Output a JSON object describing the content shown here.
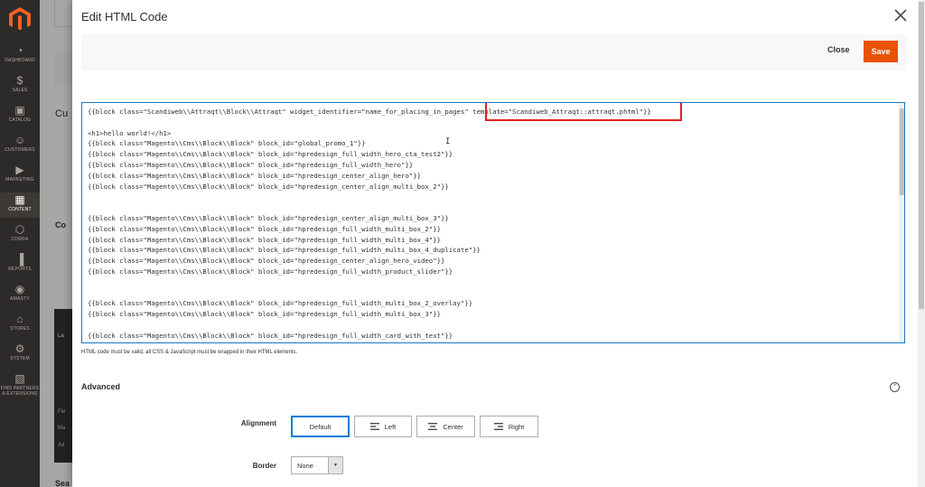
{
  "sidebar": {
    "items": [
      {
        "label": "DASHBOARD",
        "icon": "dashboard-icon"
      },
      {
        "label": "SALES",
        "icon": "dollar-icon"
      },
      {
        "label": "CATALOG",
        "icon": "cube-icon"
      },
      {
        "label": "CUSTOMERS",
        "icon": "person-icon"
      },
      {
        "label": "MARKETING",
        "icon": "megaphone-icon"
      },
      {
        "label": "CONTENT",
        "icon": "layout-icon"
      },
      {
        "label": "CORRA",
        "icon": "hexagon-icon"
      },
      {
        "label": "REPORTS",
        "icon": "bar-chart-icon"
      },
      {
        "label": "AMASTY",
        "icon": "amasty-icon"
      },
      {
        "label": "STORES",
        "icon": "store-icon"
      },
      {
        "label": "SYSTEM",
        "icon": "gear-icon"
      },
      {
        "label": "FIND PARTNERS & EXTENSIONS",
        "icon": "box-icon"
      }
    ],
    "active": "CONTENT"
  },
  "background": {
    "text_cu": "Cu",
    "text_co": "Co",
    "text_la": "La",
    "text_fle": "Fle",
    "text_ma": "Ma",
    "text_ad": "Ad",
    "text_sea": "Sea"
  },
  "modal": {
    "title": "Edit HTML Code",
    "close_label": "Close",
    "save_label": "Save"
  },
  "code": {
    "lines": [
      "{{block class=\"Scandiweb\\\\Attraqt\\\\Block\\\\Attraqt\" widget_identifier=\"name_for_placing_in_pages\" template=\"Scandiweb_Attraqt::attraqt.phtml\"}}",
      "",
      "<h1>hello world!</h1>",
      "{{block class=\"Magento\\\\Cms\\\\Block\\\\Block\" block_id=\"global_promo_1\"}}",
      "{{block class=\"Magento\\\\Cms\\\\Block\\\\Block\" block_id=\"hpredesign_full_width_hero_cta_test2\"}}",
      "{{block class=\"Magento\\\\Cms\\\\Block\\\\Block\" block_id=\"hpredesign_full_width_hero\"}}",
      "{{block class=\"Magento\\\\Cms\\\\Block\\\\Block\" block_id=\"hpredesign_center_align_hero\"}}",
      "{{block class=\"Magento\\\\Cms\\\\Block\\\\Block\" block_id=\"hpredesign_center_align_multi_box_2\"}}",
      "",
      "",
      "{{block class=\"Magento\\\\Cms\\\\Block\\\\Block\" block_id=\"hpredesign_center_align_multi_box_3\"}}",
      "{{block class=\"Magento\\\\Cms\\\\Block\\\\Block\" block_id=\"hpredesign_full_width_multi_box_2\"}}",
      "{{block class=\"Magento\\\\Cms\\\\Block\\\\Block\" block_id=\"hpredesign_full_width_multi_box_4\"}}",
      "{{block class=\"Magento\\\\Cms\\\\Block\\\\Block\" block_id=\"hpredesign_full_width_multi_box_4_duplicate\"}}",
      "{{block class=\"Magento\\\\Cms\\\\Block\\\\Block\" block_id=\"hpredesign_center_align_hero_video\"}}",
      "{{block class=\"Magento\\\\Cms\\\\Block\\\\Block\" block_id=\"hpredesign_full_width_product_slider\"}}",
      "",
      "",
      "{{block class=\"Magento\\\\Cms\\\\Block\\\\Block\" block_id=\"hpredesign_full_width_multi_box_2_overlay\"}}",
      "{{block class=\"Magento\\\\Cms\\\\Block\\\\Block\" block_id=\"hpredesign_full_width_multi_box_3\"}}",
      "",
      "{{block class=\"Magento\\\\Cms\\\\Block\\\\Block\" block_id=\"hpredesign_full_width_card_with_text\"}}"
    ],
    "note": "HTML code must be valid, all CSS & JavaScript must be wrapped in their HTML elements."
  },
  "advanced": {
    "title": "Advanced",
    "alignment_label": "Alignment",
    "alignment_options": [
      "Default",
      "Left",
      "Center",
      "Right"
    ],
    "alignment_selected": "Default",
    "border_label": "Border",
    "border_value": "None"
  },
  "colors": {
    "accent": "#eb5202",
    "highlight": "#e02020",
    "focus": "#1979c3"
  }
}
